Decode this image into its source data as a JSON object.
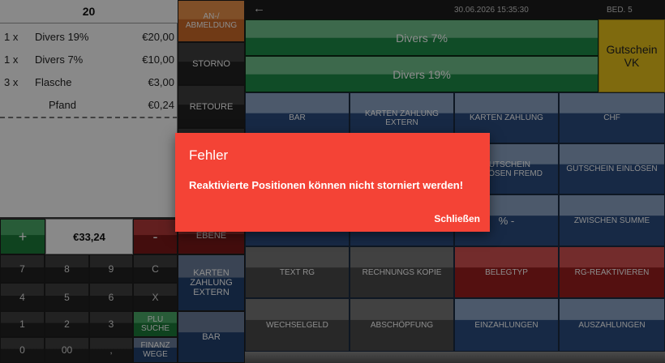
{
  "receipt": {
    "table_no": "20",
    "lines": [
      {
        "qty": "1 x",
        "name": "Divers 19%",
        "price": "€20,00"
      },
      {
        "qty": "1 x",
        "name": "Divers 7%",
        "price": "€10,00"
      },
      {
        "qty": "3 x",
        "name": "Flasche",
        "price": "€3,00"
      },
      {
        "qty": "",
        "name": "Pfand",
        "price": "€0,24"
      }
    ],
    "total": "€33,24"
  },
  "keypad": {
    "plus": "+",
    "minus": "-",
    "keys": [
      "7",
      "8",
      "9",
      "C",
      "4",
      "5",
      "6",
      "X",
      "1",
      "2",
      "3",
      "PLU SUCHE",
      "0",
      "00",
      ","
    ],
    "finanz_wege": "FINANZ WEGE"
  },
  "side_column": {
    "anmeldung": "AN-/ ABMELDUNG",
    "storno": "STORNO",
    "retoure": "RETOURE",
    "ebene": "EBENE",
    "karten_zahlung_extern": "KARTEN ZAHLUNG EXTERN",
    "bar": "BAR"
  },
  "topbar": {
    "datetime": "30.06.2026 15:35:30",
    "operator": "BED. 5"
  },
  "articles": {
    "divers7": "Divers 7%",
    "divers19": "Divers 19%",
    "gutschein_vk": "Gutschein VK"
  },
  "payments": [
    [
      "BAR",
      "KARTEN ZAHLUNG EXTERN",
      "KARTEN ZAHLUNG",
      "CHF"
    ],
    [
      "",
      "",
      "GUTSCHEIN EINLÖSEN FREMD",
      "GUTSCHEIN EINLÖSEN"
    ],
    [
      "",
      "",
      "% -",
      "ZWISCHEN SUMME"
    ],
    [
      "TEXT RG",
      "RECHNUNGS KOPIE",
      "BELEGTYP",
      "RG-REAKTIVIEREN"
    ],
    [
      "WECHSELGELD",
      "ABSCHÖPFUNG",
      "EINZAHLUNGEN",
      "AUSZAHLUNGEN"
    ]
  ],
  "dialog": {
    "title": "Fehler",
    "message": "Reaktivierte Positionen können nicht storniert werden!",
    "close": "Schließen"
  },
  "colors": {
    "dialog_bg": "#f44336",
    "article_green": "#1e8a47",
    "payment_blue": "#2a4c7e",
    "gutschein_yellow": "#e8c21a"
  }
}
